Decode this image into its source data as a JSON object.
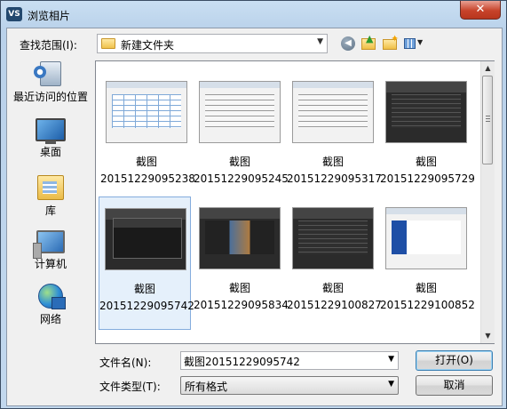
{
  "window": {
    "title": "浏览相片",
    "icon_text": "VS",
    "close_label": "✕"
  },
  "lookin": {
    "label": "查找范围(I):",
    "value": "新建文件夹"
  },
  "toolbar": {
    "back": "back-icon",
    "up": "up-folder-icon",
    "new_folder": "new-folder-icon",
    "views": "views-menu-icon"
  },
  "places": [
    {
      "label": "最近访问的位置"
    },
    {
      "label": "桌面"
    },
    {
      "label": "库"
    },
    {
      "label": "计算机"
    },
    {
      "label": "网络"
    }
  ],
  "files": [
    {
      "name": "截图",
      "number": "20151229095238",
      "selected": false
    },
    {
      "name": "截图",
      "number": "20151229095245",
      "selected": false
    },
    {
      "name": "截图",
      "number": "20151229095317",
      "selected": false
    },
    {
      "name": "截图",
      "number": "20151229095729",
      "selected": false
    },
    {
      "name": "截图",
      "number": "20151229095742",
      "selected": true
    },
    {
      "name": "截图",
      "number": "20151229095834",
      "selected": false
    },
    {
      "name": "截图",
      "number": "20151229100827",
      "selected": false
    },
    {
      "name": "截图",
      "number": "20151229100852",
      "selected": false
    }
  ],
  "filename": {
    "label": "文件名(N):",
    "value": "截图20151229095742"
  },
  "filetype": {
    "label": "文件类型(T):",
    "value": "所有格式"
  },
  "buttons": {
    "open": "打开(O)",
    "cancel": "取消"
  },
  "colors": {
    "selection": "#e5f0fb",
    "title_bar": "#c9dff2",
    "close_button": "#c7432a"
  }
}
